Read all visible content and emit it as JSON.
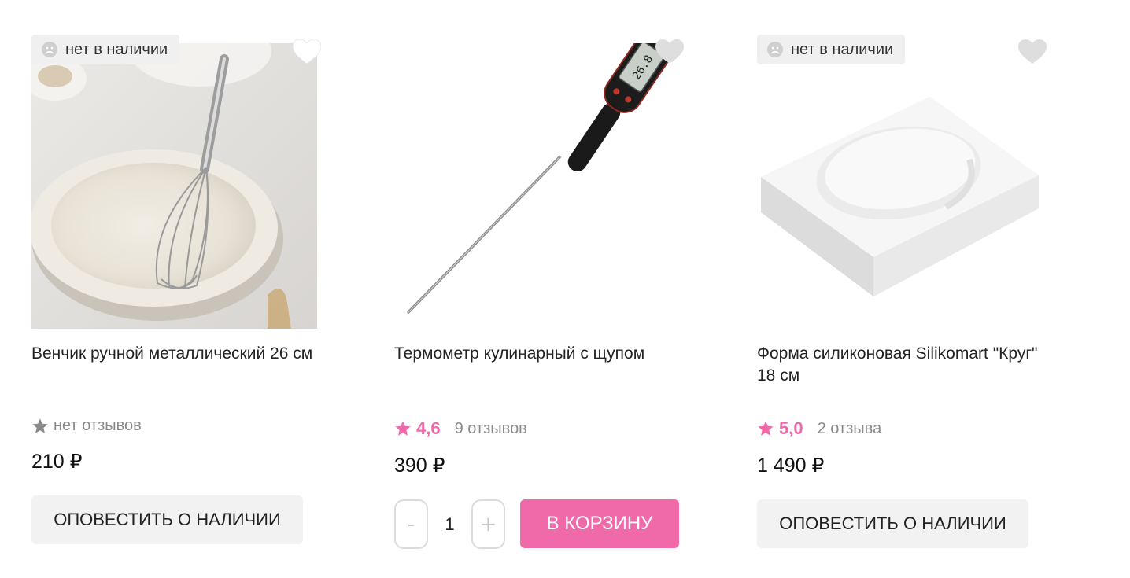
{
  "products": [
    {
      "badge": "нет в наличии",
      "title": "Венчик ручной металлический 26 см",
      "reviews": "нет отзывов",
      "price": "210 ₽",
      "action": "ОПОВЕСТИТЬ О НАЛИЧИИ",
      "in_stock": false
    },
    {
      "title": "Термометр кулинарный с щупом",
      "rating": "4,6",
      "reviews": "9 отзывов",
      "price": "390 ₽",
      "qty": "1",
      "qty_minus": "-",
      "qty_plus": "+",
      "action": "В КОРЗИНУ",
      "display_reading": "26.8",
      "in_stock": true
    },
    {
      "badge": "нет в наличии",
      "title": "Форма силиконовая Silikomart \"Круг\" 18 см",
      "rating": "5,0",
      "reviews": "2 отзыва",
      "price": "1 490 ₽",
      "action": "ОПОВЕСТИТЬ О НАЛИЧИИ",
      "in_stock": false
    }
  ],
  "colors": {
    "accent": "#f06aaa",
    "muted_text": "#8a8a8a",
    "badge_bg": "#f0f0f0",
    "button_bg": "#f2f2f2"
  },
  "icons": {
    "favorite": "heart-icon",
    "out_of_stock": "sad-face-icon",
    "rating": "star-icon"
  }
}
